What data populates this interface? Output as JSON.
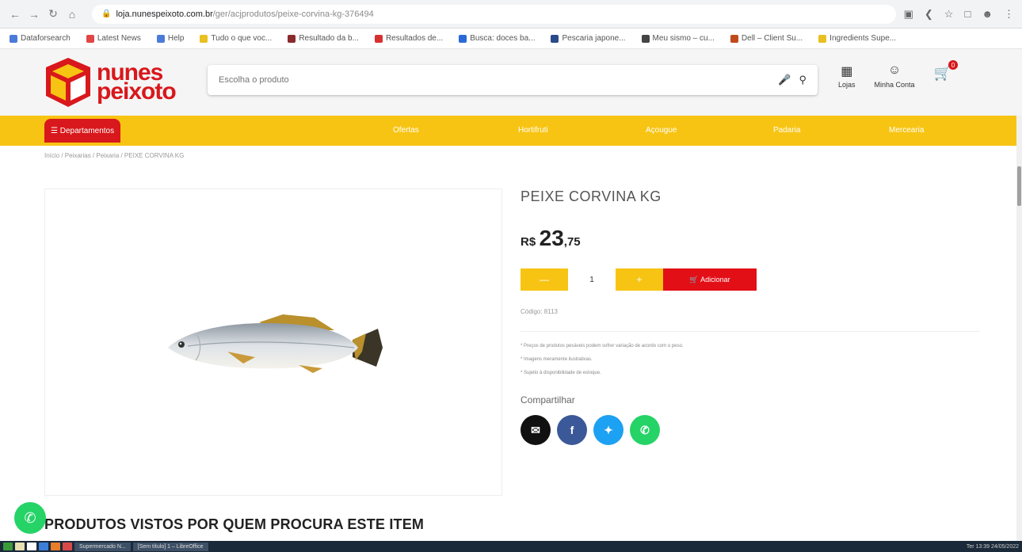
{
  "browser": {
    "url_host": "loja.nunespeixoto.com.br",
    "url_path": "/ger/acjprodutos/peixe-corvina-kg-376494",
    "bookmarks": [
      "Dataforsearch",
      "Latest News",
      "Help",
      "Tudo o que voc...",
      "Resultado da b...",
      "Resultados de...",
      "Busca: doces ba...",
      "Pescaria japone...",
      "Meu sismo – cu...",
      "Dell – Client Su...",
      "Ingredients Supe..."
    ]
  },
  "header": {
    "logo_line1": "nunes",
    "logo_line2": "peixoto",
    "search_placeholder": "Escolha o produto",
    "stores_label": "Lojas",
    "account_label": "Minha Conta",
    "cart_count": "0"
  },
  "nav": {
    "departments": "Departamentos",
    "links": [
      "Ofertas",
      "Hortifruti",
      "Açougue",
      "Padaria",
      "Mercearia"
    ]
  },
  "breadcrumb": "Início / Peixarias / Peixaria / PEIXE CORVINA KG",
  "product": {
    "title": "PEIXE CORVINA KG",
    "currency": "R$",
    "price_int": "23",
    "price_dec": ",75",
    "qty_minus": "—",
    "qty": "1",
    "qty_plus": "+",
    "add_label": "Adicionar",
    "code": "Código: 8113",
    "notes": [
      "* Preços de produtos pesáveis podem sofrer variação de acordo com o peso.",
      "* Imagens meramente ilustrativas.",
      "* Sujeito à disponibilidade de estoque."
    ],
    "share_label": "Compartilhar"
  },
  "section_title": "PRODUTOS VISTOS POR QUEM PROCURA ESTE ITEM",
  "taskbar": {
    "tasks": [
      "Supermercado N...",
      "[Sem título] 1 – LibreOffice"
    ],
    "clock": "Ter 13:39 24/05/2022"
  },
  "colors": {
    "brand_red": "#d8181c",
    "brand_yellow": "#f7c413"
  }
}
